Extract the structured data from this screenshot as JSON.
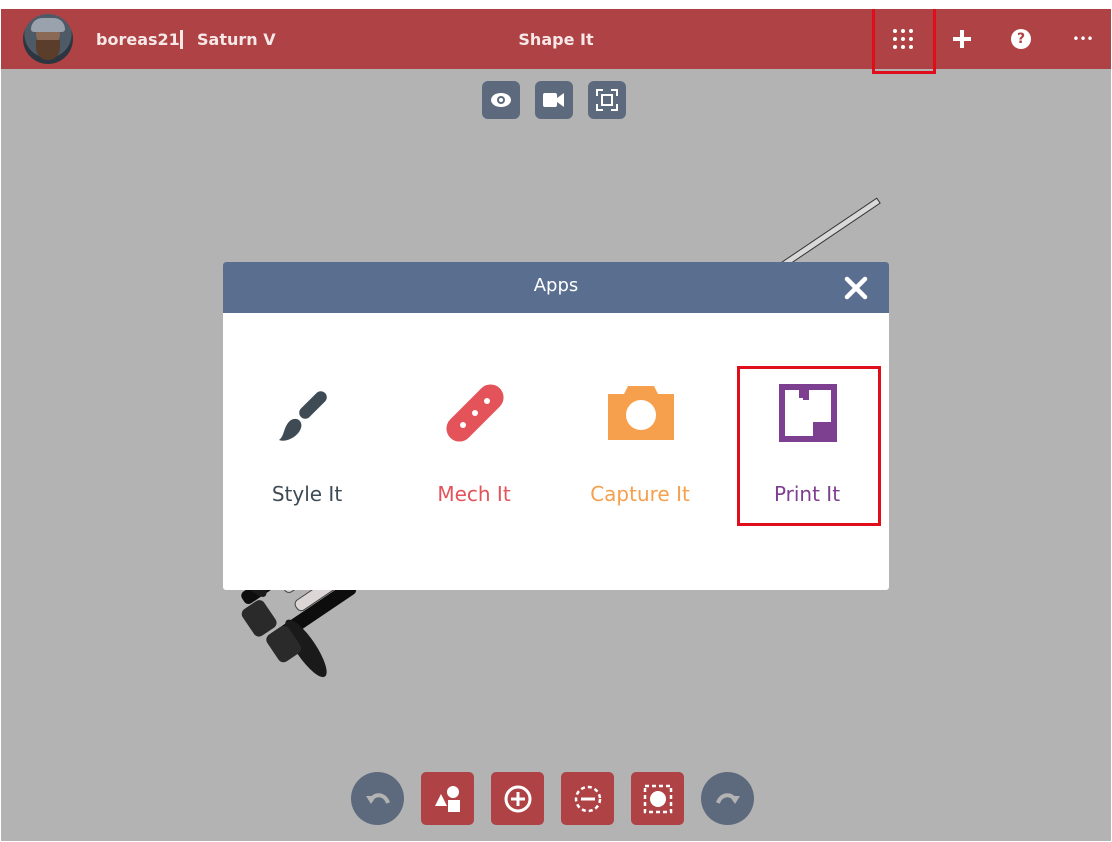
{
  "topbar": {
    "username": "boreas21",
    "project": "Saturn V",
    "app_title": "Shape It",
    "apps_icon": "apps-grid-icon",
    "add_icon": "plus-icon",
    "help_icon": "help-icon",
    "help_glyph": "?",
    "more_icon": "more-horizontal-icon",
    "more_glyph": "•••",
    "color": "#ae4245"
  },
  "view_tools": [
    "eye-icon",
    "camera-video-icon",
    "fit-view-icon"
  ],
  "bottom_tools": [
    "undo-icon",
    "shapes-icon",
    "add-shape-icon",
    "hole-icon",
    "solid-icon",
    "redo-icon"
  ],
  "modal": {
    "title": "Apps",
    "header_color": "#5a6f90",
    "apps": [
      {
        "label": "Style It",
        "icon": "paintbrush-icon",
        "color": "#3e4b55"
      },
      {
        "label": "Mech It",
        "icon": "mech-link-icon",
        "color": "#e4525a"
      },
      {
        "label": "Capture It",
        "icon": "camera-icon",
        "color": "#f6a04d"
      },
      {
        "label": "Print It",
        "icon": "print-box-icon",
        "color": "#7d3f8f"
      }
    ]
  },
  "highlight_color": "#e00e1b"
}
